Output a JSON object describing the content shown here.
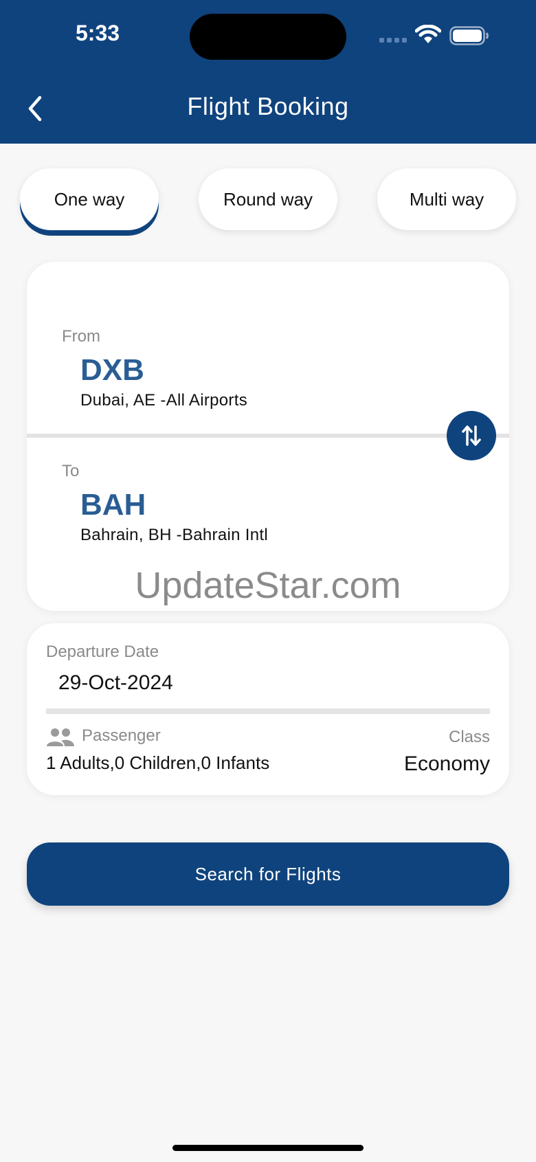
{
  "status_bar": {
    "time": "5:33"
  },
  "header": {
    "title": "Flight Booking",
    "back_icon": "chevron-left-icon"
  },
  "trip_types": [
    {
      "label": "One way",
      "selected": true
    },
    {
      "label": "Round way",
      "selected": false
    },
    {
      "label": "Multi way",
      "selected": false
    }
  ],
  "route": {
    "from_label": "From",
    "from_code": "DXB",
    "from_name": "Dubai,  AE -All Airports",
    "to_label": "To",
    "to_code": "BAH",
    "to_name": "Bahrain, BH -Bahrain Intl",
    "swap_icon": "swap-vertical-icon"
  },
  "watermark": "UpdateStar.com",
  "details": {
    "departure_label": "Departure Date",
    "departure_value": "29-Oct-2024",
    "passenger_label": "Passenger",
    "passenger_value": "1 Adults,0 Children,0 Infants",
    "class_label": "Class",
    "class_value": "Economy"
  },
  "search_button": {
    "label": "Search for Flights"
  },
  "colors": {
    "primary": "#0f437d",
    "code_text": "#2a5d94",
    "background": "#f7f7f7"
  }
}
